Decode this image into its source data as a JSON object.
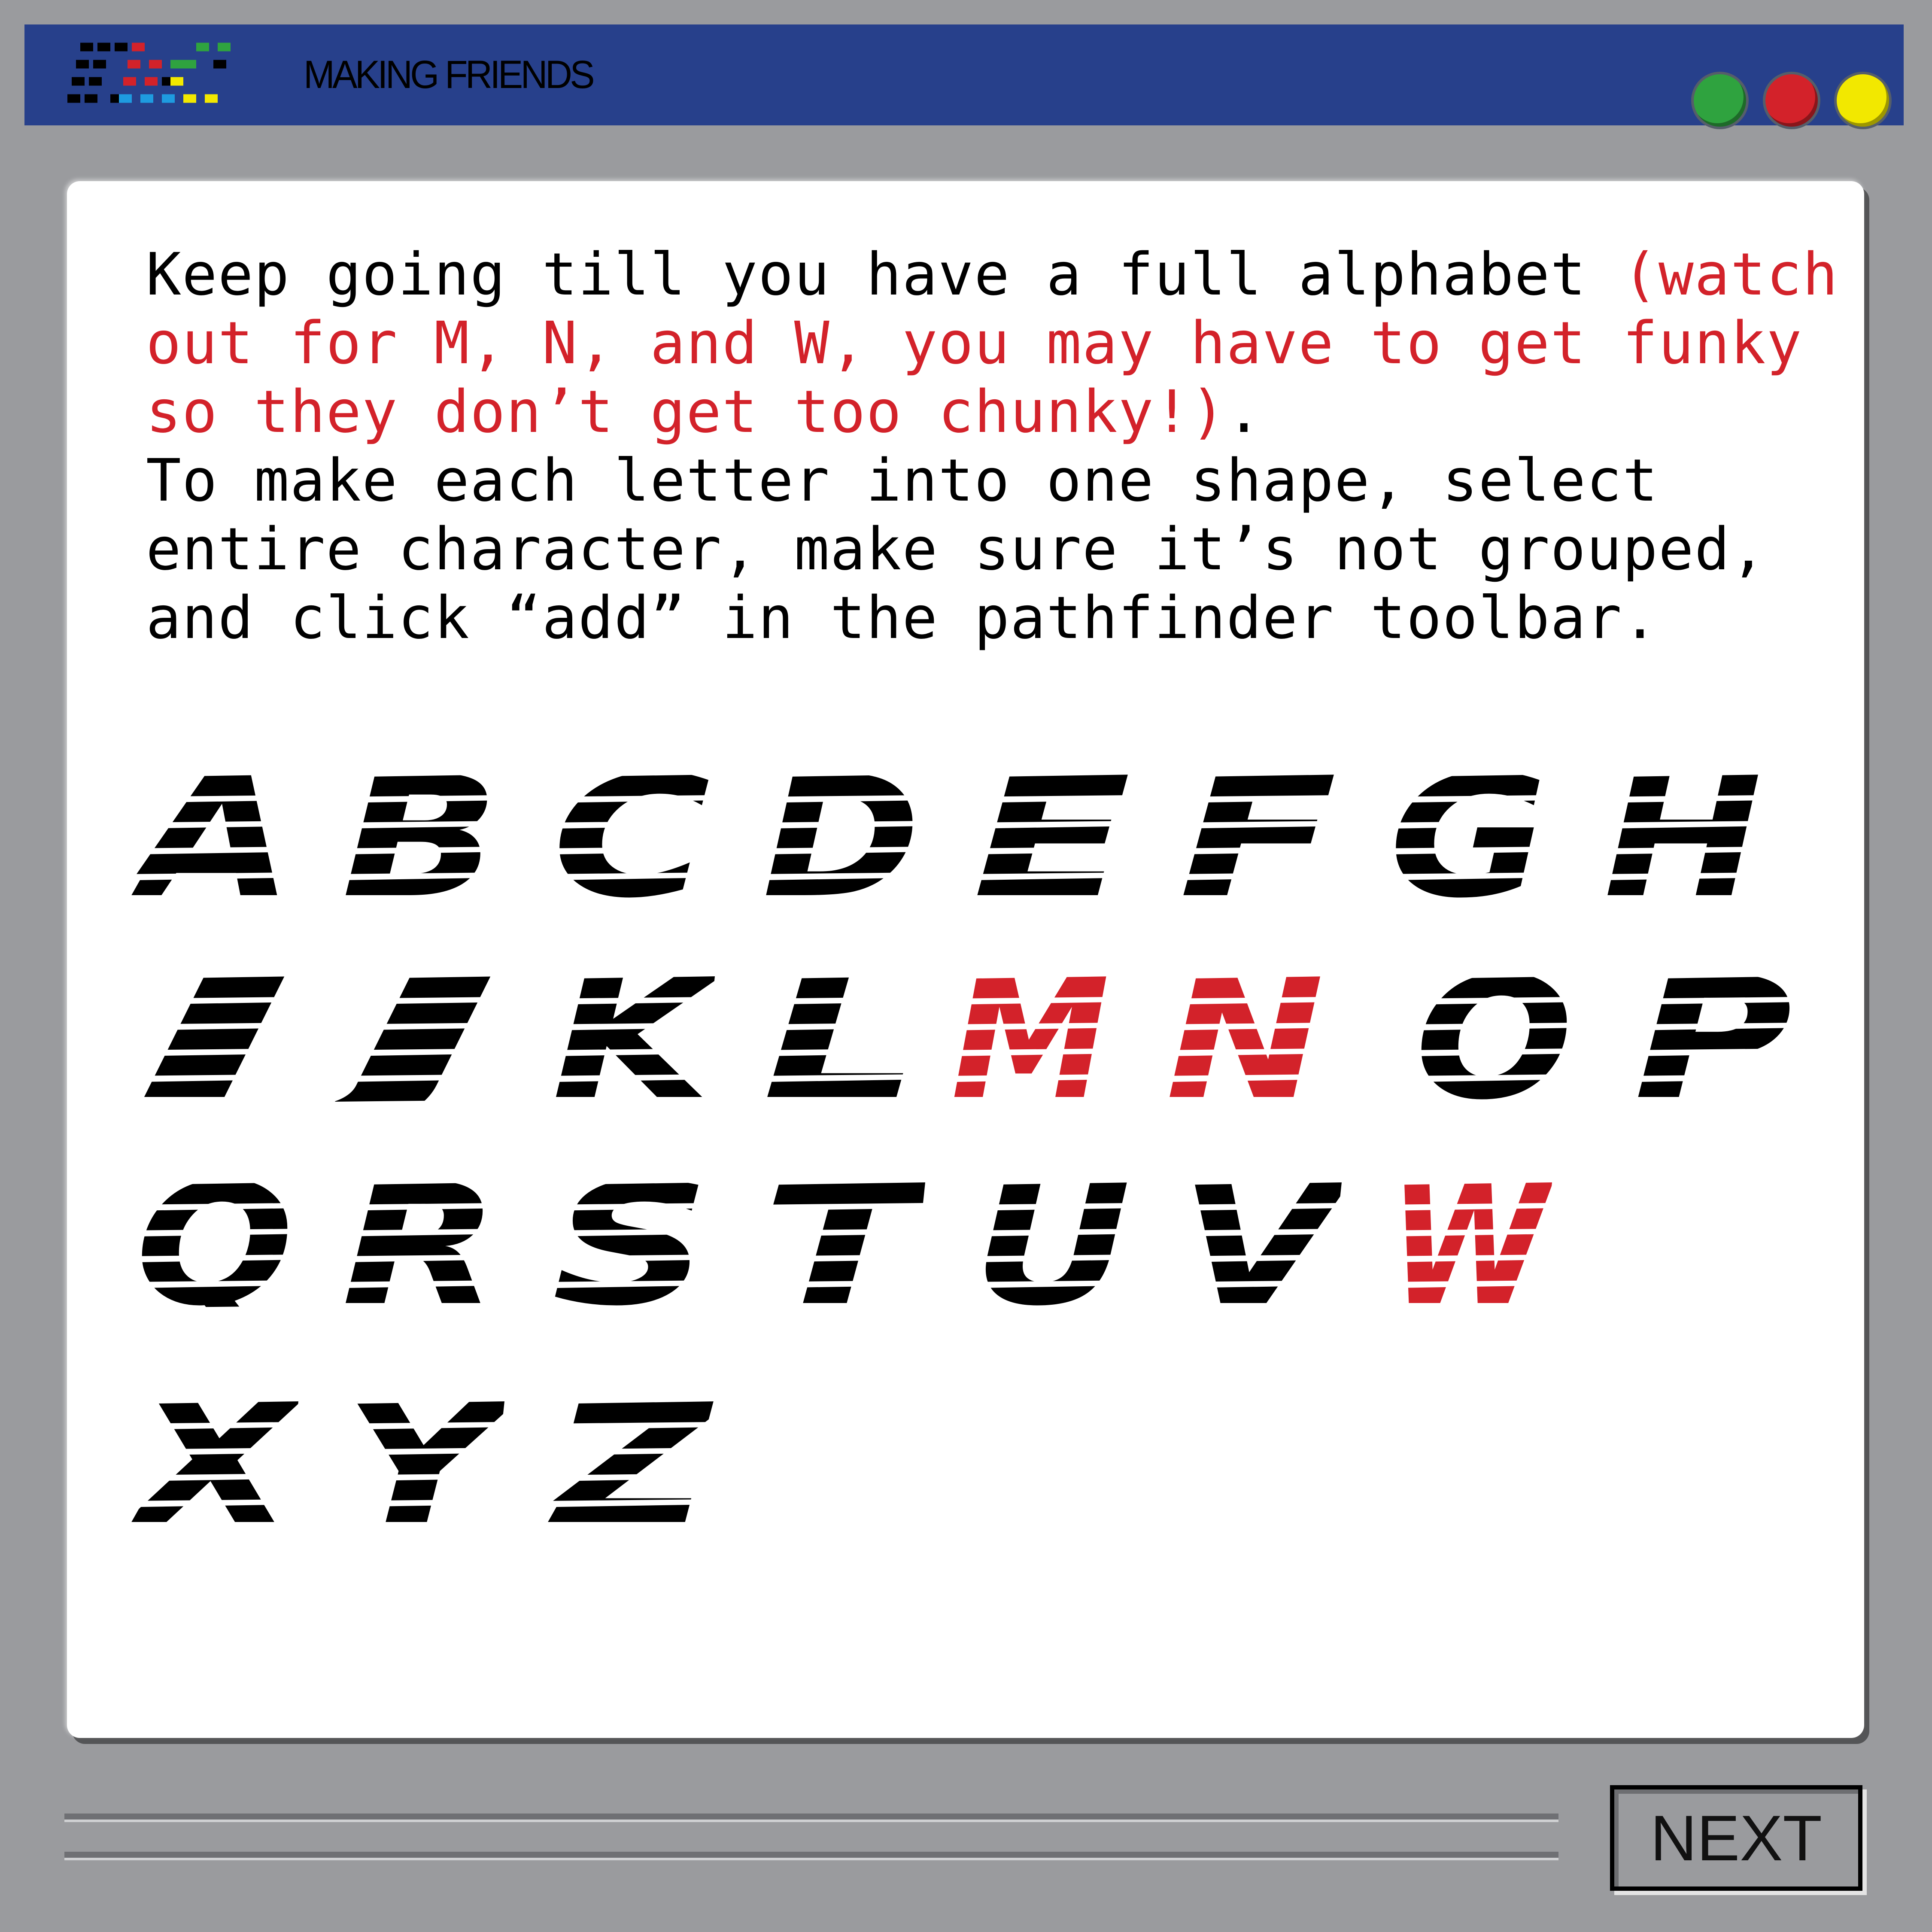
{
  "window": {
    "title": "MAKING FRIENDS",
    "logo_icon": "pixel-dc-logo-icon",
    "controls": [
      {
        "name": "green",
        "color": "#2fa33f"
      },
      {
        "name": "red",
        "color": "#d3222a"
      },
      {
        "name": "yellow",
        "color": "#f2e800"
      }
    ]
  },
  "instructions": {
    "part1": "Keep going till you have a full alphabet ",
    "highlight": "(watch out for M, N, and W, you may have to get funky so they don’t get too chunky!)",
    "part2": ".",
    "paragraph2": "To make each letter into one shape, select entire character, make sure it’s not grouped, and click “add” in the pathfinder toolbar."
  },
  "alphabet": {
    "letters": [
      "A",
      "B",
      "C",
      "D",
      "E",
      "F",
      "G",
      "H",
      "I",
      "J",
      "K",
      "L",
      "M",
      "N",
      "O",
      "P",
      "Q",
      "R",
      "S",
      "T",
      "U",
      "V",
      "W",
      "X",
      "Y",
      "Z"
    ],
    "highlighted": [
      "M",
      "N",
      "W"
    ],
    "colors": {
      "normal": "#000000",
      "highlight": "#d3222a"
    }
  },
  "footer": {
    "next_label": "NEXT"
  }
}
